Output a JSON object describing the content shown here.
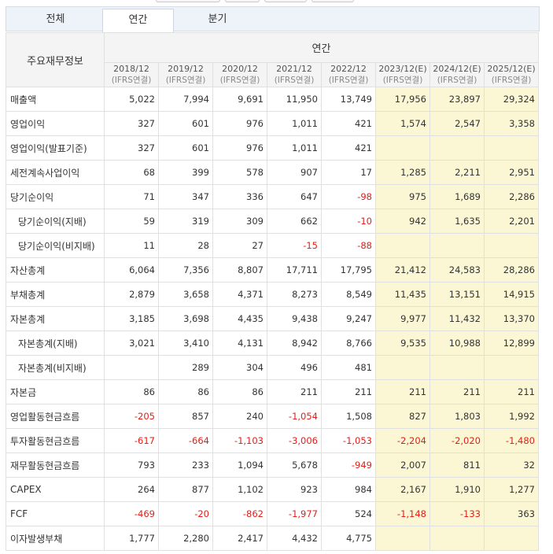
{
  "tabs": [
    {
      "label": "전체",
      "active": false
    },
    {
      "label": "연간",
      "active": true
    },
    {
      "label": "분기",
      "active": false
    }
  ],
  "table": {
    "item_header": "주요재무정보",
    "period_header": "연간",
    "columns": [
      {
        "year": "2018/12",
        "basis": "(IFRS연결)",
        "estimate": false
      },
      {
        "year": "2019/12",
        "basis": "(IFRS연결)",
        "estimate": false
      },
      {
        "year": "2020/12",
        "basis": "(IFRS연결)",
        "estimate": false
      },
      {
        "year": "2021/12",
        "basis": "(IFRS연결)",
        "estimate": false
      },
      {
        "year": "2022/12",
        "basis": "(IFRS연결)",
        "estimate": false
      },
      {
        "year": "2023/12(E)",
        "basis": "(IFRS연결)",
        "estimate": true
      },
      {
        "year": "2024/12(E)",
        "basis": "(IFRS연결)",
        "estimate": true
      },
      {
        "year": "2025/12(E)",
        "basis": "(IFRS연결)",
        "estimate": true
      }
    ],
    "rows": [
      {
        "label": "매출액",
        "indent": false,
        "values": [
          "5,022",
          "7,994",
          "9,691",
          "11,950",
          "13,749",
          "17,956",
          "23,897",
          "29,324"
        ]
      },
      {
        "label": "영업이익",
        "indent": false,
        "values": [
          "327",
          "601",
          "976",
          "1,011",
          "421",
          "1,574",
          "2,547",
          "3,358"
        ]
      },
      {
        "label": "영업이익(발표기준)",
        "indent": false,
        "values": [
          "327",
          "601",
          "976",
          "1,011",
          "421",
          "",
          "",
          ""
        ]
      },
      {
        "label": "세전계속사업이익",
        "indent": false,
        "values": [
          "68",
          "399",
          "578",
          "907",
          "17",
          "1,285",
          "2,211",
          "2,951"
        ]
      },
      {
        "label": "당기순이익",
        "indent": false,
        "values": [
          "71",
          "347",
          "336",
          "647",
          "-98",
          "975",
          "1,689",
          "2,286"
        ]
      },
      {
        "label": "당기순이익(지배)",
        "indent": true,
        "values": [
          "59",
          "319",
          "309",
          "662",
          "-10",
          "942",
          "1,635",
          "2,201"
        ]
      },
      {
        "label": "당기순이익(비지배)",
        "indent": true,
        "values": [
          "11",
          "28",
          "27",
          "-15",
          "-88",
          "",
          "",
          ""
        ]
      },
      {
        "label": "자산총계",
        "indent": false,
        "values": [
          "6,064",
          "7,356",
          "8,807",
          "17,711",
          "17,795",
          "21,412",
          "24,583",
          "28,286"
        ]
      },
      {
        "label": "부채총계",
        "indent": false,
        "values": [
          "2,879",
          "3,658",
          "4,371",
          "8,273",
          "8,549",
          "11,435",
          "13,151",
          "14,915"
        ]
      },
      {
        "label": "자본총계",
        "indent": false,
        "values": [
          "3,185",
          "3,698",
          "4,435",
          "9,438",
          "9,247",
          "9,977",
          "11,432",
          "13,370"
        ]
      },
      {
        "label": "자본총계(지배)",
        "indent": true,
        "values": [
          "3,021",
          "3,410",
          "4,131",
          "8,942",
          "8,766",
          "9,535",
          "10,988",
          "12,899"
        ]
      },
      {
        "label": "자본총계(비지배)",
        "indent": true,
        "values": [
          "",
          "289",
          "304",
          "496",
          "481",
          "",
          "",
          ""
        ]
      },
      {
        "label": "자본금",
        "indent": false,
        "values": [
          "86",
          "86",
          "86",
          "211",
          "211",
          "211",
          "211",
          "211"
        ]
      },
      {
        "label": "영업활동현금흐름",
        "indent": false,
        "values": [
          "-205",
          "857",
          "240",
          "-1,054",
          "1,508",
          "827",
          "1,803",
          "1,992"
        ]
      },
      {
        "label": "투자활동현금흐름",
        "indent": false,
        "values": [
          "-617",
          "-664",
          "-1,103",
          "-3,006",
          "-1,053",
          "-2,204",
          "-2,020",
          "-1,480"
        ]
      },
      {
        "label": "재무활동현금흐름",
        "indent": false,
        "values": [
          "793",
          "233",
          "1,094",
          "5,678",
          "-949",
          "2,007",
          "811",
          "32"
        ]
      },
      {
        "label": "CAPEX",
        "indent": false,
        "values": [
          "264",
          "877",
          "1,102",
          "923",
          "984",
          "2,167",
          "1,910",
          "1,277"
        ]
      },
      {
        "label": "FCF",
        "indent": false,
        "values": [
          "-469",
          "-20",
          "-862",
          "-1,977",
          "524",
          "-1,148",
          "-133",
          "363"
        ]
      },
      {
        "label": "이자발생부채",
        "indent": false,
        "values": [
          "1,777",
          "2,280",
          "2,417",
          "4,432",
          "4,775",
          "",
          "",
          ""
        ]
      }
    ]
  },
  "colors": {
    "negative": "#e0201a",
    "estimate_bg": "#fbf7d5",
    "header_bg": "#f4f4f4"
  }
}
